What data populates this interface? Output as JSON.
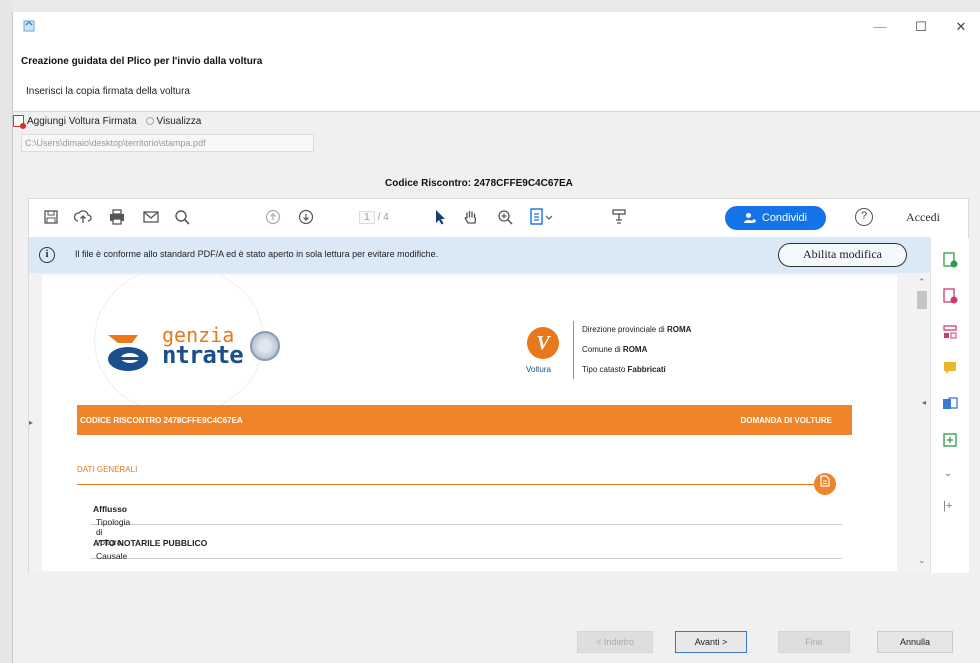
{
  "window": {
    "title": "Creazione guidata del Plico per l'invio dalla voltura",
    "subtitle": "Inserisci la copia firmata della voltura",
    "controls": {
      "minimize": "—",
      "maximize": "☐",
      "close": "✕"
    }
  },
  "file_picker": {
    "add_label": "Aggiungi Voltura Firmata",
    "view_label": "Visualizza",
    "path": "C:\\Users\\dimaio\\desktop\\territorio\\stampa.pdf"
  },
  "codice_riscontro": "Codice Riscontro: 2478CFFE9C4C67EA",
  "viewer": {
    "toolbar_icons": [
      "save-icon",
      "upload-icon",
      "print-icon",
      "mail-icon",
      "zoom-out-icon",
      "page-up-icon",
      "page-down-icon",
      "select-arrow-icon",
      "hand-icon",
      "zoom-in-icon",
      "fit-icon",
      "stamp-icon"
    ],
    "page_current": "1",
    "page_total": "/ 4",
    "share_label": "Condividi",
    "help_label": "?",
    "login_label": "Accedi",
    "notice": "Il file è conforme allo standard PDF/A ed è stato aperto in sola lettura per evitare modifiche.",
    "enable_edit_label": "Abilita modifica"
  },
  "document": {
    "logo_top": "genzia",
    "logo_bottom": "ntrate",
    "voltura_icon_letter": "V",
    "voltura_label": "Voltura",
    "ente": [
      {
        "prefix": "Direzione provinciale di ",
        "value": "ROMA"
      },
      {
        "prefix": "Comune di ",
        "value": "ROMA"
      },
      {
        "prefix": "Tipo catasto ",
        "value": "Fabbricati"
      }
    ],
    "bar_left": "CODICE RISCONTRO 2478CFFE9C4C67EA",
    "bar_right": "DOMANDA DI VOLTURE",
    "section_title": "DATI GENERALI",
    "rows": [
      {
        "label": "Tipologia di voltura ",
        "value": "Afflusso"
      },
      {
        "label": "Causale ",
        "value": "ATTO NOTARILE PUBBLICO"
      }
    ]
  },
  "footer": {
    "back_label": "< Indietro",
    "next_label": "Avanti >",
    "finish_label": "Fine",
    "cancel_label": "Annulla"
  },
  "colors": {
    "accent_blue": "#1473e6",
    "agenzia_orange": "#f0842a",
    "agenzia_blue": "#1b4f8b",
    "notice_bg": "#dbe8f5"
  }
}
